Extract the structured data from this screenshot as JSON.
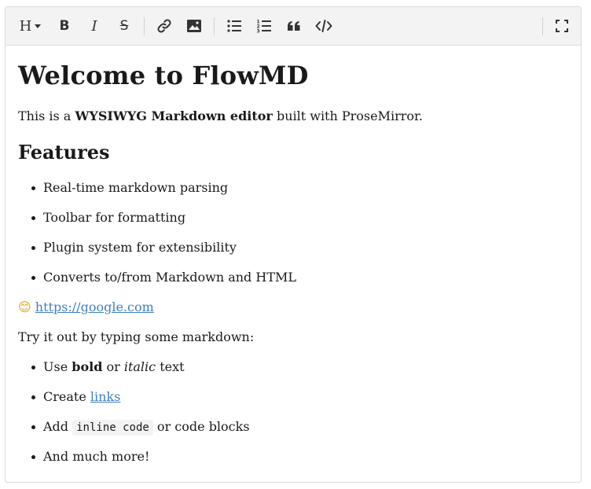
{
  "toolbar": {
    "buttons": [
      {
        "name": "heading-dropdown-button",
        "label": "H"
      },
      {
        "name": "bold-button",
        "label": "B"
      },
      {
        "name": "italic-button",
        "label": "I"
      },
      {
        "name": "strikethrough-button",
        "label": "S"
      },
      {
        "name": "link-button",
        "icon": "link-icon"
      },
      {
        "name": "image-button",
        "icon": "image-icon"
      },
      {
        "name": "bullet-list-button",
        "icon": "bullet-list-icon"
      },
      {
        "name": "ordered-list-button",
        "icon": "ordered-list-icon"
      },
      {
        "name": "blockquote-button",
        "icon": "quote-icon"
      },
      {
        "name": "code-button",
        "icon": "code-icon"
      },
      {
        "name": "fullscreen-button",
        "icon": "fullscreen-icon"
      }
    ]
  },
  "doc": {
    "title": "Welcome to FlowMD",
    "intro": {
      "before": "This is a ",
      "bold": "WYSIWYG Markdown editor",
      "after": " built with ProseMirror."
    },
    "features_heading": "Features",
    "features": [
      "Real-time markdown parsing",
      "Toolbar for formatting",
      "Plugin system for extensibility",
      "Converts to/from Markdown and HTML"
    ],
    "emoji": "😊",
    "emoji_link": "https://google.com",
    "try_text": "Try it out by typing some markdown:",
    "tips": {
      "bold_line": {
        "before": "Use ",
        "bold": "bold",
        "mid": " or ",
        "italic": "italic",
        "after": " text"
      },
      "link_line": {
        "before": "Create ",
        "link": "links"
      },
      "code_line": {
        "before": "Add ",
        "code": "inline code",
        "after": " or code blocks"
      },
      "more_line": "And much more!"
    }
  },
  "colors": {
    "link": "#3f7fbf",
    "toolbar_bg": "#f3f3f3",
    "border": "#dcdcdc"
  }
}
